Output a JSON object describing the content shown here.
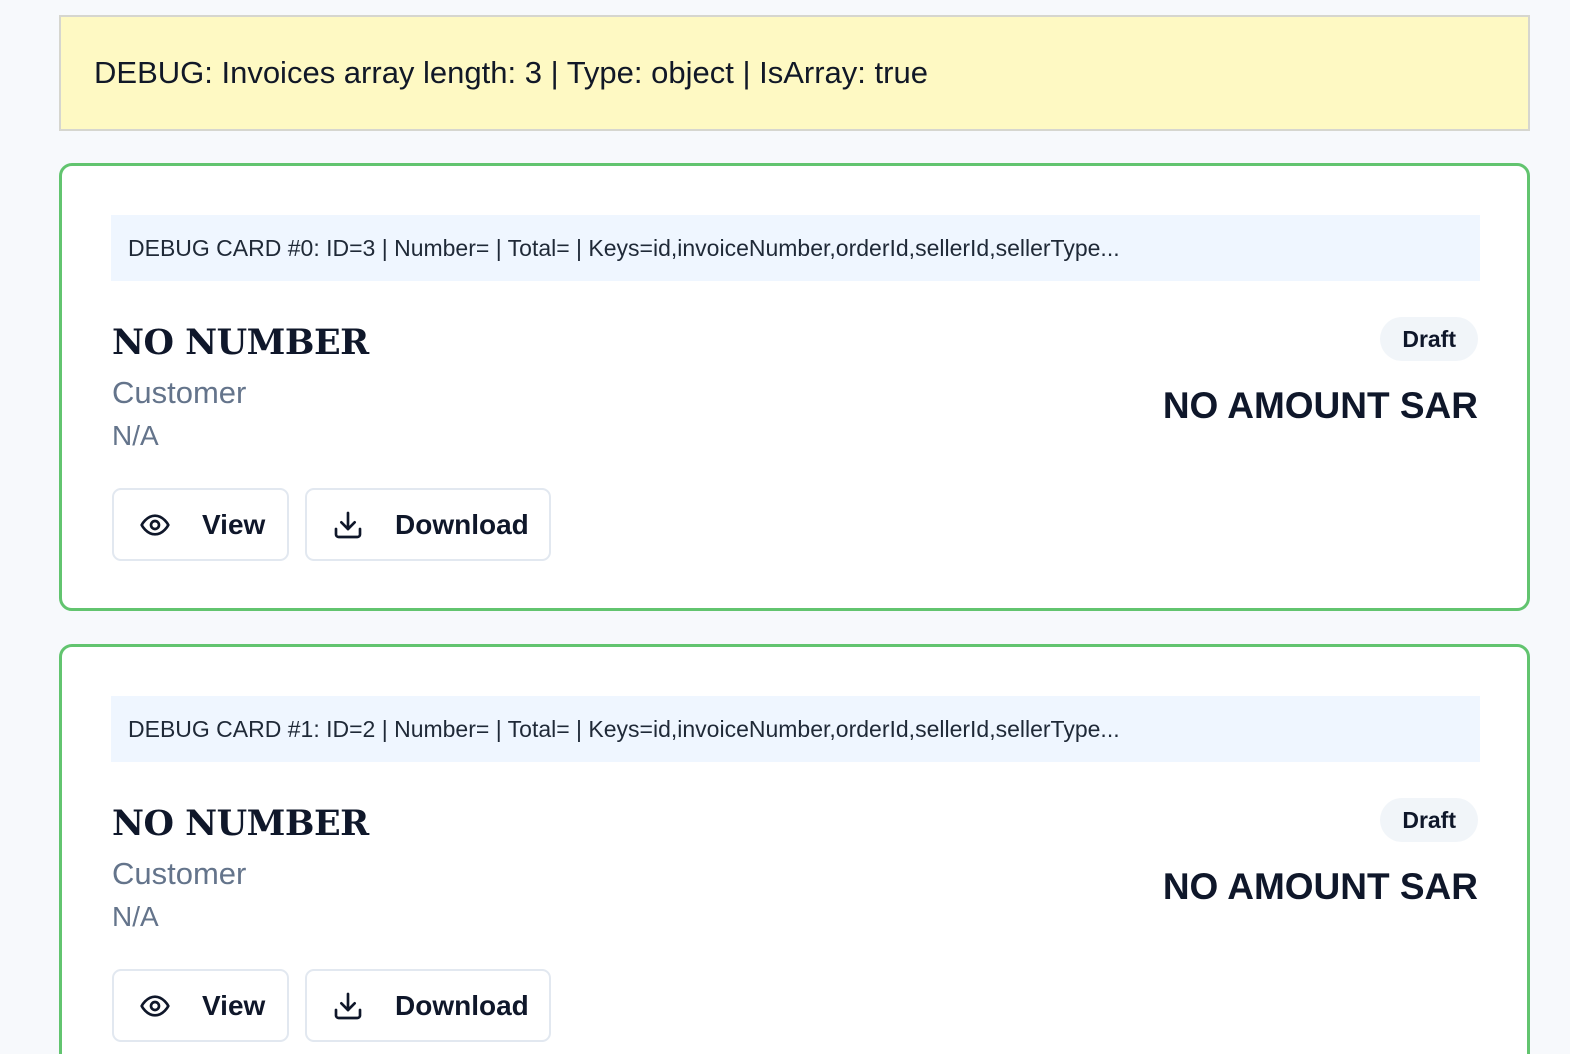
{
  "debug_banner": {
    "text": "DEBUG: Invoices array length: 3 | Type: object | IsArray: true"
  },
  "cards": [
    {
      "debug_text": "DEBUG CARD #0: ID=3 | Number= | Total= | Keys=id,invoiceNumber,orderId,sellerId,sellerType...",
      "invoice_number": "NO NUMBER",
      "customer_label": "Customer",
      "customer_value": "N/A",
      "status": "Draft",
      "amount": "NO AMOUNT SAR",
      "view_label": "View",
      "download_label": "Download"
    },
    {
      "debug_text": "DEBUG CARD #1: ID=2 | Number= | Total= | Keys=id,invoiceNumber,orderId,sellerId,sellerType...",
      "invoice_number": "NO NUMBER",
      "customer_label": "Customer",
      "customer_value": "N/A",
      "status": "Draft",
      "amount": "NO AMOUNT SAR",
      "view_label": "View",
      "download_label": "Download"
    }
  ],
  "icons": {
    "view": "eye-icon",
    "download": "download-icon"
  },
  "colors": {
    "background": "#f7f9fc",
    "debug_banner_bg": "#fef9c3",
    "card_border": "#62c46f",
    "card_debug_bg": "#eff6ff",
    "badge_bg": "#f1f5f9",
    "muted_text": "#64748b"
  }
}
